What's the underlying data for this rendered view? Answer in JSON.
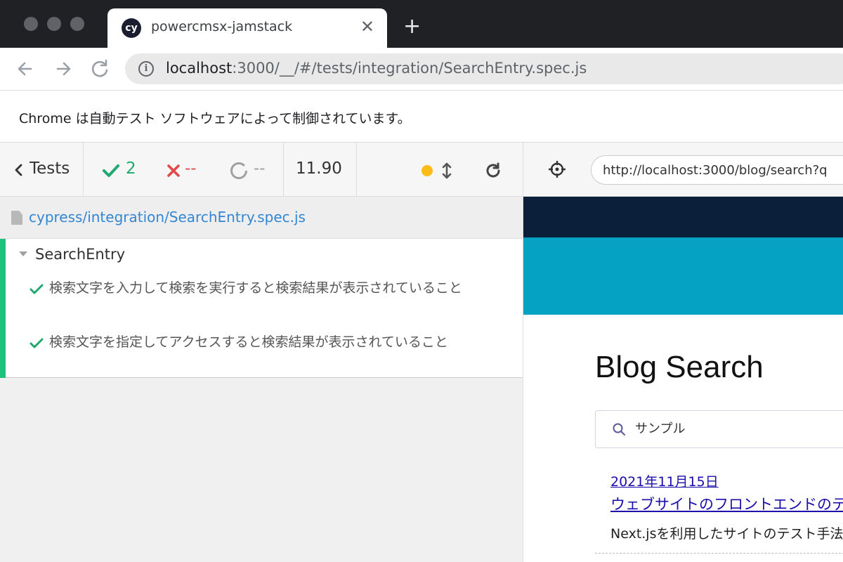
{
  "browser": {
    "tab_title": "powercmsx-jamstack",
    "tab_favicon_text": "cy",
    "new_tab": "+",
    "close": "✕",
    "url_host": "localhost",
    "url_rest": ":3000/__/#/tests/integration/SearchEntry.spec.js",
    "infobar_message": "Chrome は自動テスト ソフトウェアによって制御されています。"
  },
  "reporter": {
    "tests_label": "Tests",
    "passed": "2",
    "failed": "--",
    "pending": "--",
    "duration": "11.90",
    "spec_path": "cypress/integration/SearchEntry.spec.js",
    "suite_title": "SearchEntry",
    "tests": [
      {
        "title": "検索文字を入力して検索を実行すると検索結果が表示されていること"
      },
      {
        "title": "検索文字を指定してアクセスすると検索結果が表示されていること"
      }
    ]
  },
  "aut": {
    "url": "http://localhost:3000/blog/search?q",
    "heading": "Blog Search",
    "search_value": "サンプル",
    "result": {
      "date": "2021年11月15日",
      "title": "ウェブサイトのフロントエンドのテ",
      "excerpt": "Next.jsを利用したサイトのテスト手法"
    }
  },
  "colors": {
    "pass": "#1fa971",
    "fail": "#e24a4a",
    "pending": "#a0a0a0",
    "running_dot": "#fbbc17",
    "suite_bar": "#1fc27a",
    "link": "#3386d4"
  }
}
